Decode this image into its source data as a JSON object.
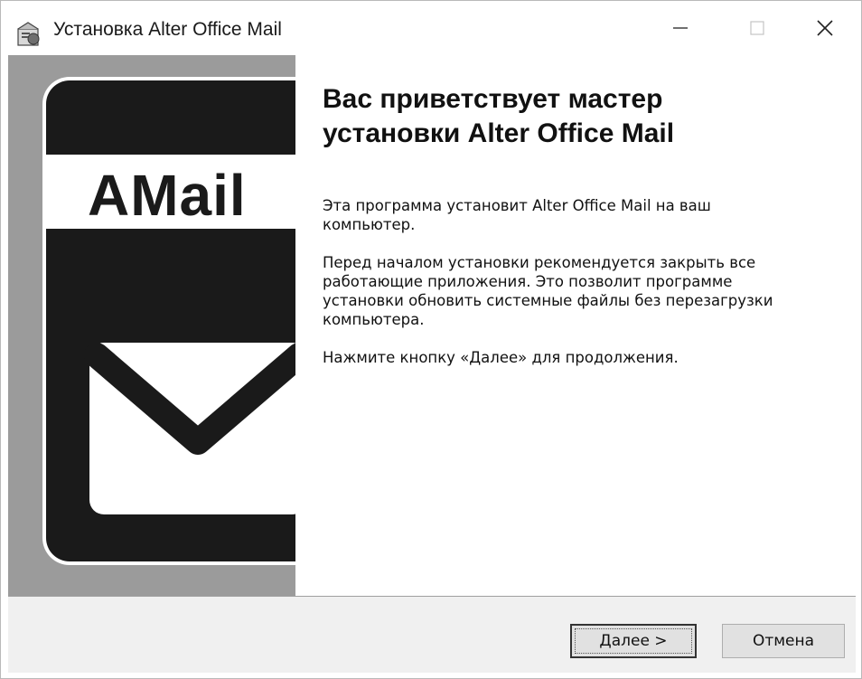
{
  "window": {
    "title": "Установка Alter Office Mail",
    "controls": {
      "minimize": "minimize-icon",
      "maximize": "maximize-icon",
      "close": "close-icon"
    }
  },
  "banner": {
    "brand": "AMail",
    "icon": "mail-envelope-icon"
  },
  "welcome": {
    "heading_line1": "Вас приветствует мастер",
    "heading_line2": "установки Alter Office Mail",
    "p1_line1": "Эта программа установит Alter Office Mail на ваш",
    "p1_line2": "компьютер.",
    "p2_line1": "Перед началом установки рекомендуется закрыть все",
    "p2_line2": "работающие приложения. Это позволит программе",
    "p2_line3": "установки обновить системные файлы без перезагрузки",
    "p2_line4": "компьютера.",
    "p3": "Нажмите кнопку «Далее» для продолжения."
  },
  "buttons": {
    "next": "Далее >",
    "cancel": "Отмена"
  },
  "colors": {
    "banner_bg": "#9b9b9b",
    "banner_dark": "#1a1a1a",
    "footer_bg": "#f0f0f0",
    "button_bg": "#e1e1e1"
  }
}
